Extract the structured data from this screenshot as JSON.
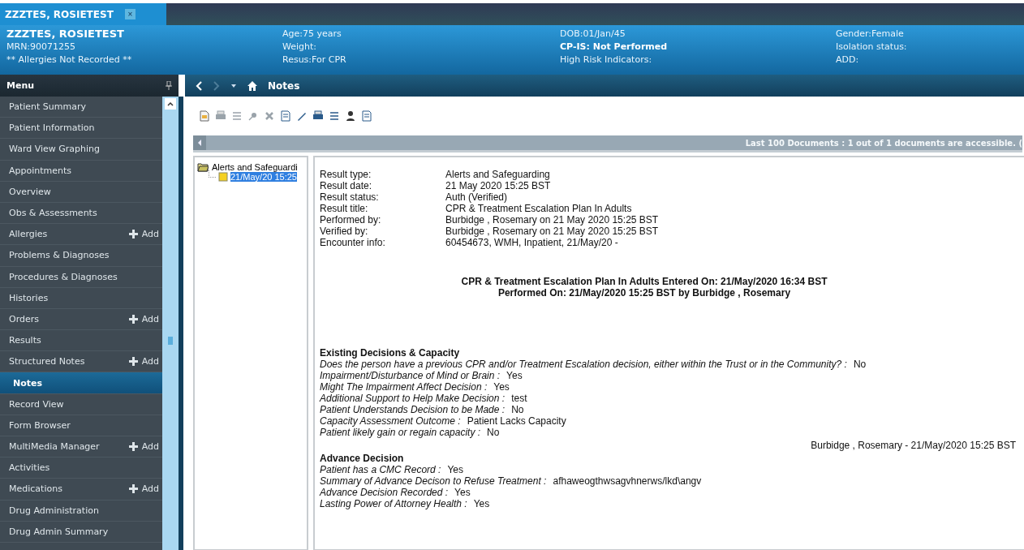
{
  "patient_tab": {
    "title": "ZZZTES, ROSIETEST",
    "close": "×"
  },
  "banner": {
    "name": "ZZZTES, ROSIETEST",
    "mrn": "MRN:90071255",
    "allergies": "** Allergies Not Recorded **",
    "columns": [
      {
        "lines": [
          {
            "text": "Age:75 years",
            "bold": false
          },
          {
            "text": "Weight:",
            "bold": false
          },
          {
            "text": "Resus:For CPR",
            "bold": false
          }
        ]
      },
      {
        "lines": [
          {
            "text": "DOB:01/Jan/45",
            "bold": false
          },
          {
            "text": "CP-IS: Not Performed",
            "bold": true
          },
          {
            "text": "High Risk Indicators:",
            "bold": false
          }
        ]
      },
      {
        "lines": [
          {
            "text": "Gender:Female",
            "bold": false
          },
          {
            "text": "Isolation status:",
            "bold": false
          },
          {
            "text": "ADD:",
            "bold": false
          }
        ]
      }
    ]
  },
  "menu": {
    "title": "Menu",
    "items": [
      {
        "label": "Patient Summary",
        "selected": false
      },
      {
        "label": "Patient Information",
        "selected": false
      },
      {
        "label": "Ward View Graphing",
        "selected": false
      },
      {
        "label": "Appointments",
        "selected": false
      },
      {
        "label": "Overview",
        "selected": false
      },
      {
        "label": "Obs & Assessments",
        "selected": false
      },
      {
        "label": "Allergies",
        "selected": false,
        "add": "Add"
      },
      {
        "label": "Problems & Diagnoses",
        "selected": false
      },
      {
        "label": "Procedures & Diagnoses",
        "selected": false
      },
      {
        "label": "Histories",
        "selected": false
      },
      {
        "label": "Orders",
        "selected": false,
        "add": "Add"
      },
      {
        "label": "Results",
        "selected": false
      },
      {
        "label": "Structured Notes",
        "selected": false,
        "add": "Add"
      },
      {
        "label": "Notes",
        "selected": true
      },
      {
        "label": "Record View",
        "selected": false
      },
      {
        "label": "Form Browser",
        "selected": false
      },
      {
        "label": "MultiMedia Manager",
        "selected": false,
        "add": "Add"
      },
      {
        "label": "Activities",
        "selected": false
      },
      {
        "label": "Medications",
        "selected": false,
        "add": "Add"
      },
      {
        "label": "Drug Administration",
        "selected": false
      },
      {
        "label": "Drug Admin Summary",
        "selected": false
      }
    ]
  },
  "navbar": {
    "title": "Notes"
  },
  "info_bar": {
    "text": "Last 100 Documents : 1 out of 1 documents are accessible. ("
  },
  "tree": [
    {
      "label": "Alerts and Safeguardi",
      "expanded": true,
      "children": [
        {
          "label": "21/May/20 15:25",
          "selected": true
        }
      ]
    }
  ],
  "document": {
    "fields": [
      {
        "label": "Result type:",
        "value": "Alerts and Safeguarding"
      },
      {
        "label": "Result date:",
        "value": "21 May 2020 15:25 BST"
      },
      {
        "label": "Result status:",
        "value": "Auth (Verified)"
      },
      {
        "label": "Result title:",
        "value": "CPR & Treatment Escalation Plan In Adults"
      },
      {
        "label": "Performed by:",
        "value": "Burbidge , Rosemary on 21 May 2020 15:25 BST"
      },
      {
        "label": "Verified by:",
        "value": "Burbidge , Rosemary on 21 May 2020 15:25 BST"
      },
      {
        "label": "Encounter info:",
        "value": "60454673, WMH, Inpatient, 21/May/20 -"
      }
    ],
    "title_lines": [
      "CPR & Treatment Escalation Plan In Adults Entered On:  21/May/2020 16:34 BST",
      "Performed On:  21/May/2020 15:25 BST by Burbidge , Rosemary"
    ],
    "sections": [
      {
        "heading": "Existing Decisions & Capacity",
        "items": [
          {
            "question": "Does the person have a previous CPR and/or Treatment Escalation decision, either within the Trust or in the Community? :",
            "answer": "No"
          },
          {
            "question": "Impairment/Disturbance of Mind or Brain :",
            "answer": "Yes"
          },
          {
            "question": "Might The Impairment Affect Decision :",
            "answer": "Yes"
          },
          {
            "question": "Additional Support to Help Make Decision :",
            "answer": "test"
          },
          {
            "question": "Patient Understands Decision to be Made :",
            "answer": "No"
          },
          {
            "question": "Capacity Assessment Outcome :",
            "answer": "Patient Lacks Capacity"
          },
          {
            "question": "Patient likely gain or regain capacity :",
            "answer": "No"
          }
        ],
        "signature": "Burbidge , Rosemary - 21/May/2020 15:25 BST"
      },
      {
        "heading": "Advance Decision",
        "items": [
          {
            "question": "Patient has a CMC Record :",
            "answer": "Yes"
          },
          {
            "question": "Summary of Advance Decison to Refuse Treatment :",
            "answer": "afhaweogthwsagvhnerws/lkd\\angv"
          },
          {
            "question": "Advance Decision Recorded :",
            "answer": "Yes"
          },
          {
            "question": "Lasting Power of Attorney Health :",
            "answer": "Yes"
          }
        ]
      }
    ]
  }
}
